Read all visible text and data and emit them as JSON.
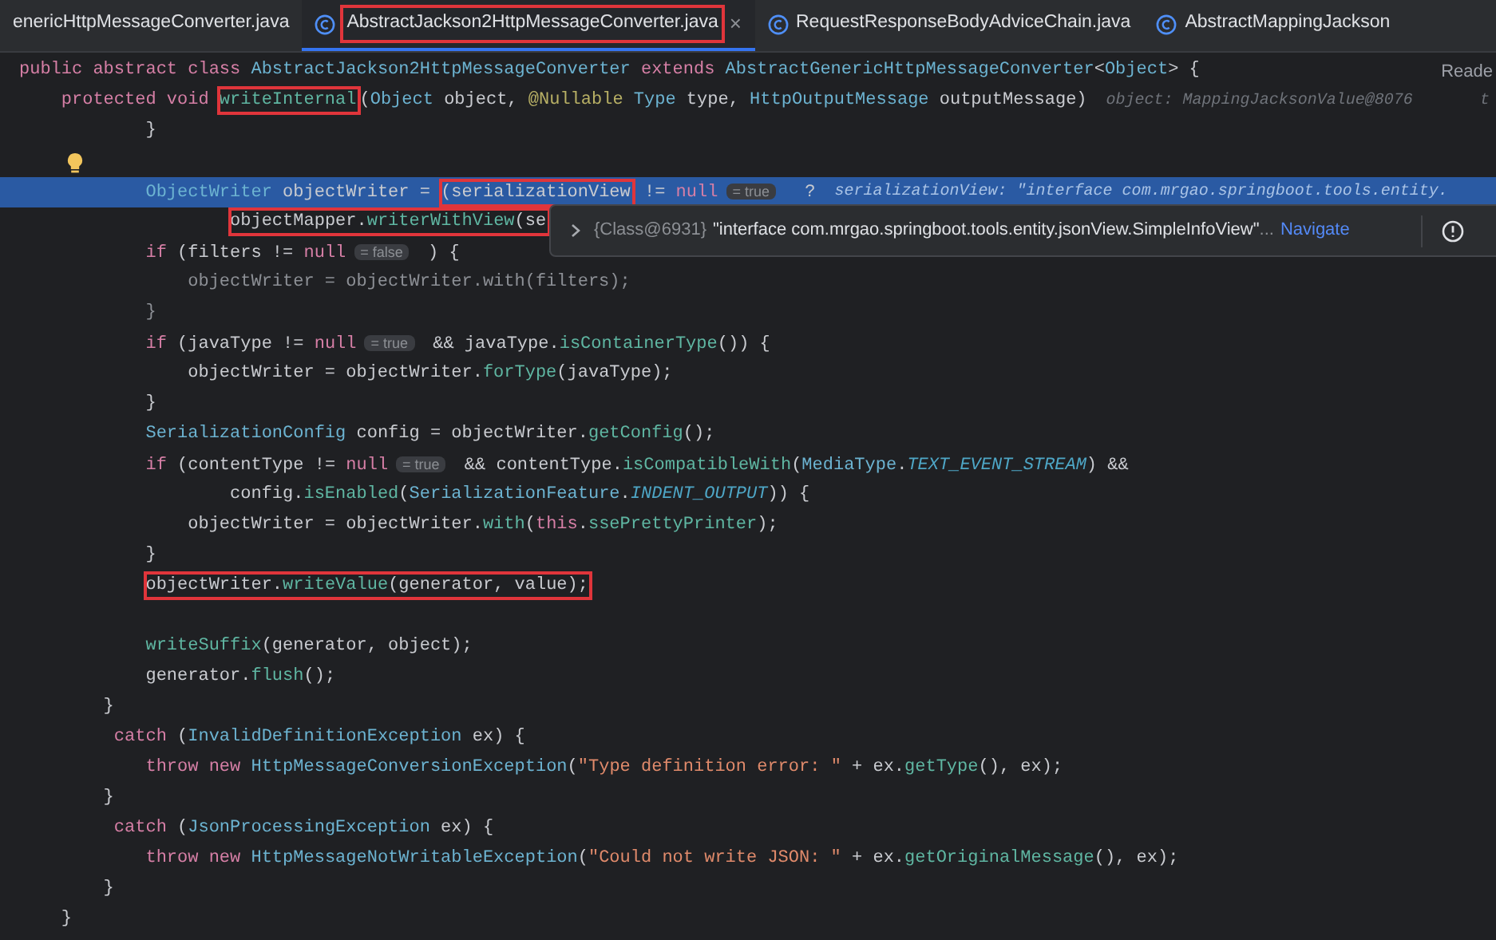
{
  "tabs": [
    {
      "label": "enericHttpMessageConverter.java",
      "icon": false,
      "selected": false,
      "highlighted": false,
      "closable": false
    },
    {
      "label": "AbstractJackson2HttpMessageConverter.java",
      "icon": true,
      "selected": true,
      "highlighted": true,
      "closable": true,
      "close": "×"
    },
    {
      "label": "RequestResponseBodyAdviceChain.java",
      "icon": true,
      "selected": false,
      "highlighted": false,
      "closable": false
    },
    {
      "label": "AbstractMappingJackson",
      "icon": true,
      "selected": false,
      "highlighted": false,
      "closable": false
    }
  ],
  "reader_mode": "Reade",
  "lines": [
    {
      "selected": false,
      "tokens": [
        {
          "text": "public abstract class ",
          "kind": "kw"
        },
        {
          "text": "AbstractJackson2HttpMessageConverter",
          "kind": "type"
        },
        {
          "text": " extends ",
          "kind": "kw"
        },
        {
          "text": "AbstractGenericHttpMessageConverter",
          "kind": "type"
        },
        {
          "text": "<",
          "kind": "plain"
        },
        {
          "text": "Object",
          "kind": "type"
        },
        {
          "text": "> {",
          "kind": "plain"
        }
      ]
    },
    {
      "selected": false,
      "tokens": [
        {
          "text": "    protected void ",
          "kind": "kw"
        },
        {
          "text": "writeInternal",
          "kind": "method",
          "boxed": true
        },
        {
          "text": "(",
          "kind": "plain"
        },
        {
          "text": "Object",
          "kind": "type"
        },
        {
          "text": " object, ",
          "kind": "plain"
        },
        {
          "text": "@Nullable",
          "kind": "ann"
        },
        {
          "text": " Type",
          "kind": "type"
        },
        {
          "text": " type, ",
          "kind": "plain"
        },
        {
          "text": "HttpOutputMessage",
          "kind": "type"
        },
        {
          "text": " outputMessage)",
          "kind": "plain"
        }
      ],
      "debug_hint": "object: MappingJacksonValue@8076",
      "trailing": "t"
    },
    {
      "selected": false,
      "tokens": [
        {
          "text": "            }",
          "kind": "plain"
        }
      ]
    },
    {
      "selected": false,
      "bulb": true
    },
    {
      "selected": true,
      "tokens": [
        {
          "text": "            ObjectWriter",
          "kind": "type"
        },
        {
          "text": " objectWriter = ",
          "kind": "plain"
        },
        {
          "text": "(serializationView",
          "kind": "plain",
          "boxed": true
        },
        {
          "text": " != ",
          "kind": "plain"
        },
        {
          "text": "null",
          "kind": "kw"
        },
        {
          "text": "= true",
          "kind": "hint"
        },
        {
          "text": "  ?",
          "kind": "plain"
        }
      ],
      "debug_hint": "serializationView: \"interface com.mrgao.springboot.tools.entity."
    },
    {
      "selected": false,
      "tokens": [
        {
          "text": "                    objectMapper.",
          "kind": "plain",
          "boxed": true
        },
        {
          "text": "writerWithView",
          "kind": "method",
          "boxed": true
        },
        {
          "text": "(se",
          "kind": "plain",
          "boxed": true
        }
      ]
    },
    {
      "selected": false,
      "tokens": [
        {
          "text": "            if",
          "kind": "kw"
        },
        {
          "text": " (filters != ",
          "kind": "plain"
        },
        {
          "text": "null",
          "kind": "kw"
        },
        {
          "text": "= false",
          "kind": "hint"
        },
        {
          "text": " ) {",
          "kind": "plain"
        }
      ]
    },
    {
      "selected": false,
      "tokens": [
        {
          "text": "                objectWriter = objectWriter.with(filters);",
          "kind": "dim"
        }
      ]
    },
    {
      "selected": false,
      "tokens": [
        {
          "text": "            }",
          "kind": "dim"
        }
      ]
    },
    {
      "selected": false,
      "tokens": [
        {
          "text": "            if",
          "kind": "kw"
        },
        {
          "text": " (javaType != ",
          "kind": "plain"
        },
        {
          "text": "null",
          "kind": "kw"
        },
        {
          "text": "= true",
          "kind": "hint"
        },
        {
          "text": " && javaType.",
          "kind": "plain"
        },
        {
          "text": "isContainerType",
          "kind": "method"
        },
        {
          "text": "()) {",
          "kind": "plain"
        }
      ]
    },
    {
      "selected": false,
      "tokens": [
        {
          "text": "                objectWriter = objectWriter.",
          "kind": "plain"
        },
        {
          "text": "forType",
          "kind": "method"
        },
        {
          "text": "(javaType);",
          "kind": "plain"
        }
      ]
    },
    {
      "selected": false,
      "tokens": [
        {
          "text": "            }",
          "kind": "plain"
        }
      ]
    },
    {
      "selected": false,
      "tokens": [
        {
          "text": "            SerializationConfig",
          "kind": "type"
        },
        {
          "text": " config = objectWriter.",
          "kind": "plain"
        },
        {
          "text": "getConfig",
          "kind": "method"
        },
        {
          "text": "();",
          "kind": "plain"
        }
      ]
    },
    {
      "selected": false,
      "tokens": [
        {
          "text": "            if",
          "kind": "kw"
        },
        {
          "text": " (contentType != ",
          "kind": "plain"
        },
        {
          "text": "null",
          "kind": "kw"
        },
        {
          "text": "= true",
          "kind": "hint"
        },
        {
          "text": " && contentType.",
          "kind": "plain"
        },
        {
          "text": "isCompatibleWith",
          "kind": "method"
        },
        {
          "text": "(",
          "kind": "plain"
        },
        {
          "text": "MediaType",
          "kind": "type"
        },
        {
          "text": ".",
          "kind": "plain"
        },
        {
          "text": "TEXT_EVENT_STREAM",
          "kind": "const"
        },
        {
          "text": ") &&",
          "kind": "plain"
        }
      ]
    },
    {
      "selected": false,
      "tokens": [
        {
          "text": "                    config.",
          "kind": "plain"
        },
        {
          "text": "isEnabled",
          "kind": "method"
        },
        {
          "text": "(",
          "kind": "plain"
        },
        {
          "text": "SerializationFeature",
          "kind": "type"
        },
        {
          "text": ".",
          "kind": "plain"
        },
        {
          "text": "INDENT_OUTPUT",
          "kind": "const"
        },
        {
          "text": ")) {",
          "kind": "plain"
        }
      ]
    },
    {
      "selected": false,
      "tokens": [
        {
          "text": "                objectWriter = objectWriter.",
          "kind": "plain"
        },
        {
          "text": "with",
          "kind": "method"
        },
        {
          "text": "(",
          "kind": "plain"
        },
        {
          "text": "this",
          "kind": "kw"
        },
        {
          "text": ".",
          "kind": "plain"
        },
        {
          "text": "ssePrettyPrinter",
          "kind": "method"
        },
        {
          "text": ");",
          "kind": "plain"
        }
      ]
    },
    {
      "selected": false,
      "tokens": [
        {
          "text": "            }",
          "kind": "plain"
        }
      ]
    },
    {
      "selected": false,
      "tokens": [
        {
          "text": "            objectWriter.",
          "kind": "plain",
          "boxed": true
        },
        {
          "text": "writeValue",
          "kind": "method",
          "boxed": true
        },
        {
          "text": "(generator, value);",
          "kind": "plain",
          "boxed": true
        }
      ]
    },
    {
      "selected": false
    },
    {
      "selected": false,
      "tokens": [
        {
          "text": "            writeSuffix",
          "kind": "method"
        },
        {
          "text": "(generator, object);",
          "kind": "plain"
        }
      ]
    },
    {
      "selected": false,
      "tokens": [
        {
          "text": "            generator.",
          "kind": "plain"
        },
        {
          "text": "flush",
          "kind": "method"
        },
        {
          "text": "();",
          "kind": "plain"
        }
      ]
    },
    {
      "selected": false,
      "tokens": [
        {
          "text": "        }",
          "kind": "plain"
        }
      ]
    },
    {
      "selected": false,
      "tokens": [
        {
          "text": "         catch",
          "kind": "kw"
        },
        {
          "text": " (",
          "kind": "plain"
        },
        {
          "text": "InvalidDefinitionException",
          "kind": "type"
        },
        {
          "text": " ex) {",
          "kind": "plain"
        }
      ]
    },
    {
      "selected": false,
      "tokens": [
        {
          "text": "            throw new ",
          "kind": "kw"
        },
        {
          "text": "HttpMessageConversionException",
          "kind": "type"
        },
        {
          "text": "(",
          "kind": "plain"
        },
        {
          "text": "\"Type definition error: \"",
          "kind": "str"
        },
        {
          "text": " + ex.",
          "kind": "plain"
        },
        {
          "text": "getType",
          "kind": "method"
        },
        {
          "text": "(), ex);",
          "kind": "plain"
        }
      ]
    },
    {
      "selected": false,
      "tokens": [
        {
          "text": "        }",
          "kind": "plain"
        }
      ]
    },
    {
      "selected": false,
      "tokens": [
        {
          "text": "         catch",
          "kind": "kw"
        },
        {
          "text": " (",
          "kind": "plain"
        },
        {
          "text": "JsonProcessingException",
          "kind": "type"
        },
        {
          "text": " ex) {",
          "kind": "plain"
        }
      ]
    },
    {
      "selected": false,
      "tokens": [
        {
          "text": "            throw new ",
          "kind": "kw"
        },
        {
          "text": "HttpMessageNotWritableException",
          "kind": "type"
        },
        {
          "text": "(",
          "kind": "plain"
        },
        {
          "text": "\"Could not write JSON: \"",
          "kind": "str"
        },
        {
          "text": " + ex.",
          "kind": "plain"
        },
        {
          "text": "getOriginalMessage",
          "kind": "method"
        },
        {
          "text": "(), ex);",
          "kind": "plain"
        }
      ]
    },
    {
      "selected": false,
      "tokens": [
        {
          "text": "        }",
          "kind": "plain"
        }
      ]
    },
    {
      "selected": false,
      "tokens": [
        {
          "text": "    }",
          "kind": "plain"
        }
      ]
    }
  ],
  "popup": {
    "ref": "{Class@6931}",
    "value": "\"interface com.mrgao.springboot.tools.entity.jsonView.SimpleInfoView\"",
    "ellipsis": "...",
    "link": "Navigate"
  }
}
